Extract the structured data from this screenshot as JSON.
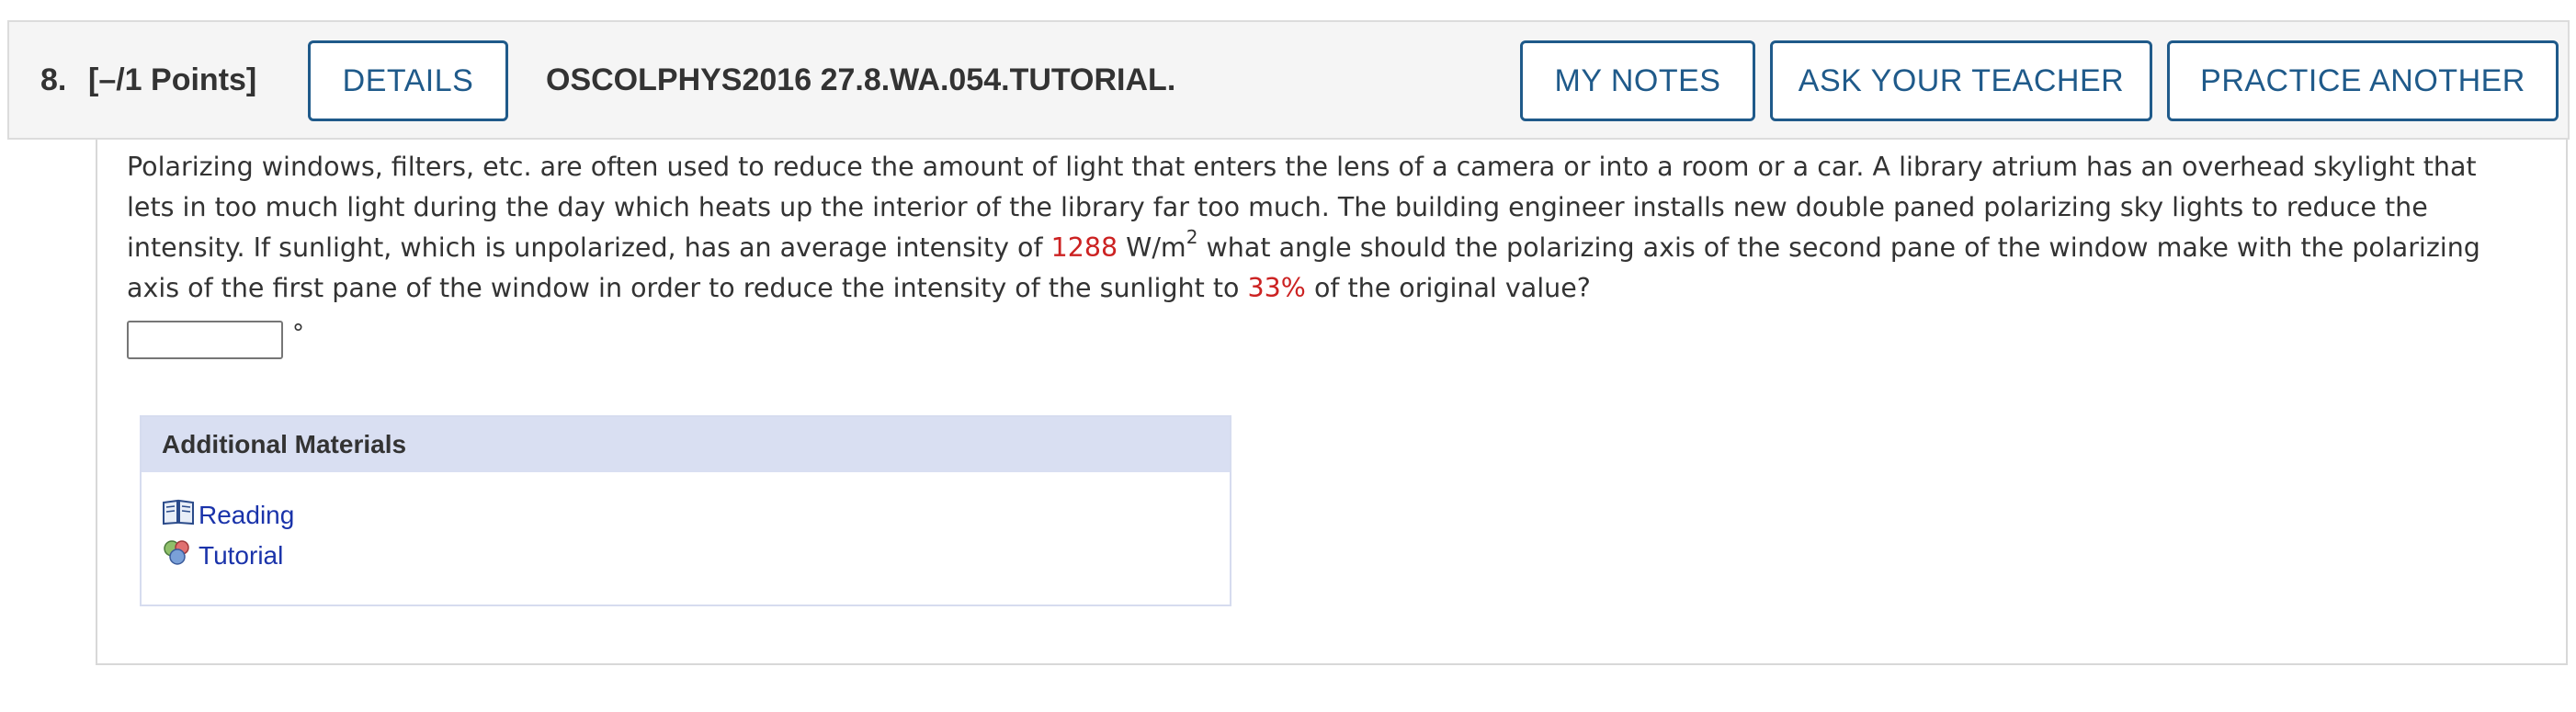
{
  "header": {
    "question_number": "8.",
    "points": "[–/1 Points]",
    "details_label": "DETAILS",
    "question_code": "OSCOLPHYS2016 27.8.WA.054.TUTORIAL.",
    "my_notes_label": "MY NOTES",
    "ask_teacher_label": "ASK YOUR TEACHER",
    "practice_another_label": "PRACTICE ANOTHER"
  },
  "problem": {
    "text_1": "Polarizing windows, filters, etc. are often used to reduce the amount of light that enters the lens of a camera or into a room or a car. A library atrium has an overhead skylight that lets in too much light during the day which heats up the interior of the library far too much. The building engineer installs new double paned polarizing sky lights to reduce the intensity. If sunlight, which is unpolarized, has an average intensity of ",
    "intensity_value": "1288",
    "unit_base": " W/m",
    "unit_exponent": "2",
    "text_2": " what angle should the polarizing axis of the second pane of the window make with the polarizing axis of the first pane of the window in order to reduce the intensity of the sunlight to ",
    "percent_value": "33%",
    "text_3": " of the original value?"
  },
  "answer": {
    "value": "",
    "unit": "°"
  },
  "additional_materials": {
    "title": "Additional Materials",
    "links": [
      {
        "label": "Reading",
        "icon": "book-icon"
      },
      {
        "label": "Tutorial",
        "icon": "tutorial-icon"
      }
    ]
  },
  "colors": {
    "accent": "#1f5a8a",
    "highlight_red": "#cc2222",
    "link": "#1a33aa",
    "materials_header_bg": "#d9dff2"
  }
}
